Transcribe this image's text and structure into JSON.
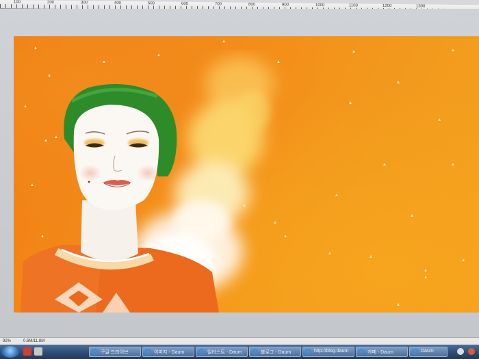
{
  "ruler": {
    "numbers": [
      "100",
      "200",
      "300",
      "400",
      "500",
      "600",
      "700",
      "800",
      "900",
      "1000",
      "1100",
      "1200",
      "1300"
    ]
  },
  "status": {
    "zoom": "92%",
    "doc_info": "0.6M/11.8M"
  },
  "taskbar": {
    "buttons": [
      {
        "label": "구글 드라이브"
      },
      {
        "label": "이미지 - Daum"
      },
      {
        "label": "일러스트 - Daum"
      },
      {
        "label": "블로그 - Daum"
      },
      {
        "label": "http://blog.daum"
      },
      {
        "label": "카페 - Daum"
      },
      {
        "label": "Daum"
      }
    ]
  },
  "colors": {
    "canvas_orange": "#f48e19",
    "headscarf_green": "#2e8b2a",
    "skin": "#fbf7f3",
    "taskbar_blue": "#2c4a72"
  },
  "icons": {
    "start": "windows-start-icon",
    "browser": "internet-explorer-icon"
  }
}
